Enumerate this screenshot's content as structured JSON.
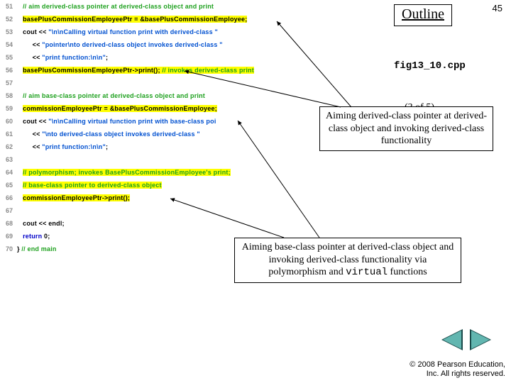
{
  "page_number": "45",
  "outline": {
    "title": "Outline"
  },
  "file_label": "fig13_10.cpp",
  "part_label": "(3 of 5)",
  "callouts": {
    "c1": "Aiming derived-class pointer at derived-class object and invoking derived-class functionality",
    "c2_pre": "Aiming base-class pointer at derived-class object and invoking derived-class functionality via polymorphism and ",
    "c2_kw": "virtual",
    "c2_post": " functions"
  },
  "nav": {
    "prev": "◀",
    "next": "▶"
  },
  "copyright": {
    "line1": "© 2008 Pearson Education,",
    "line2": "Inc.  All rights reserved."
  },
  "code": {
    "l51": "// aim derived-class pointer at derived-class object and print",
    "l52": "basePlusCommissionEmployeePtr = &basePlusCommissionEmployee;",
    "l53a": "cout << ",
    "l53b": "\"\\n\\nCalling virtual function print with derived-class \"",
    "l54a": "   << ",
    "l54b": "\"pointer\\nto derived-class object invokes derived-class \"",
    "l55a": "   << ",
    "l55b": "\"print function:\\n\\n\"",
    "l55c": ";",
    "l56a": "basePlusCommissionEmployeePtr->print();",
    "l56b": " // invokes derived-class print",
    "l58": "// aim base-class pointer at derived-class object and print",
    "l59": "commissionEmployeePtr = &basePlusCommissionEmployee;",
    "l60a": "cout << ",
    "l60b": "\"\\n\\nCalling virtual function print with base-class poi",
    "l61a": "   << ",
    "l61b": "\"\\nto derived-class object invokes derived-class \"",
    "l62a": "   << ",
    "l62b": "\"print function:\\n\\n\"",
    "l62c": ";",
    "l64": "// polymorphism; invokes BasePlusCommissionEmployee's print;",
    "l65": "// base-class pointer to derived-class object",
    "l66": "commissionEmployeePtr->print();",
    "l68": "cout << endl;",
    "l69a": "return",
    "l69b": " 0;",
    "l70a": "} ",
    "l70b": "// end main"
  },
  "line_numbers": {
    "n51": "51",
    "n52": "52",
    "n53": "53",
    "n54": "54",
    "n55": "55",
    "n56": "56",
    "n57": "57",
    "n58": "58",
    "n59": "59",
    "n60": "60",
    "n61": "61",
    "n62": "62",
    "n63": "63",
    "n64": "64",
    "n65": "65",
    "n66": "66",
    "n67": "67",
    "n68": "68",
    "n69": "69",
    "n70": "70"
  }
}
